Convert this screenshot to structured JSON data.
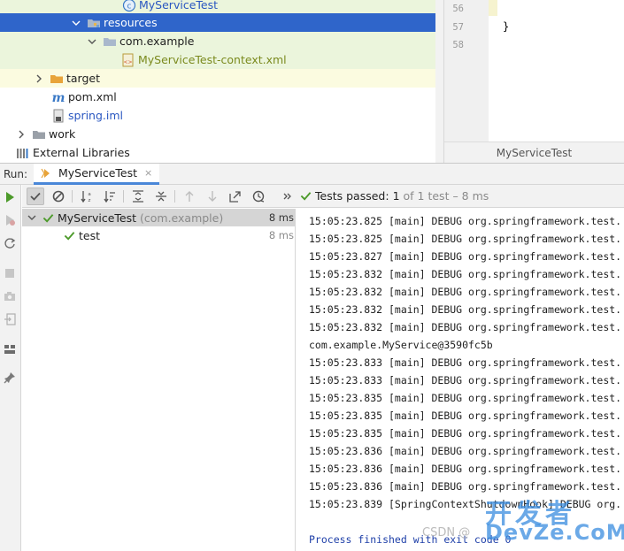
{
  "project_tree": {
    "items": [
      {
        "label": "MyServiceTest"
      },
      {
        "label": "resources"
      },
      {
        "label": "com.example"
      },
      {
        "label": "MyServiceTest-context.xml"
      },
      {
        "label": "target"
      },
      {
        "label": "pom.xml"
      },
      {
        "label": "spring.iml"
      },
      {
        "label": "work"
      },
      {
        "label": "External Libraries"
      }
    ]
  },
  "editor": {
    "line_numbers": [
      "56",
      "57",
      "58"
    ],
    "code_lines": [
      "}"
    ],
    "tab_title": "MyServiceTest"
  },
  "run_window": {
    "label": "Run:",
    "tab_label": "MyServiceTest",
    "tab_close": "×"
  },
  "test_status": {
    "prefix": "Tests passed:",
    "passed": "1",
    "detail": "of 1 test – 8 ms"
  },
  "test_results": [
    {
      "name": "MyServiceTest",
      "package": "(com.example)",
      "time": "8 ms"
    },
    {
      "name": "test",
      "time": "8 ms"
    }
  ],
  "console": {
    "lines": [
      "15:05:23.825 [main] DEBUG org.springframework.test.",
      "15:05:23.825 [main] DEBUG org.springframework.test.",
      "15:05:23.827 [main] DEBUG org.springframework.test.",
      "15:05:23.832 [main] DEBUG org.springframework.test.",
      "15:05:23.832 [main] DEBUG org.springframework.test.",
      "15:05:23.832 [main] DEBUG org.springframework.test.",
      "15:05:23.832 [main] DEBUG org.springframework.test.",
      "com.example.MyService@3590fc5b",
      "15:05:23.833 [main] DEBUG org.springframework.test.",
      "15:05:23.833 [main] DEBUG org.springframework.test.",
      "15:05:23.835 [main] DEBUG org.springframework.test.",
      "15:05:23.835 [main] DEBUG org.springframework.test.",
      "15:05:23.835 [main] DEBUG org.springframework.test.",
      "15:05:23.836 [main] DEBUG org.springframework.test.",
      "15:05:23.836 [main] DEBUG org.springframework.test.",
      "15:05:23.836 [main] DEBUG org.springframework.test.",
      "15:05:23.839 [SpringContextShutdownHook] DEBUG org."
    ],
    "finish_line": "Process finished with exit code 0"
  },
  "watermark": {
    "csdn": "CSDN @",
    "big": "开发者",
    "domain": "DevZe.CoM"
  },
  "colors": {
    "selection": "#2f65ca",
    "test_pass": "#4c9a2a",
    "tab_underline": "#4a87d8"
  }
}
